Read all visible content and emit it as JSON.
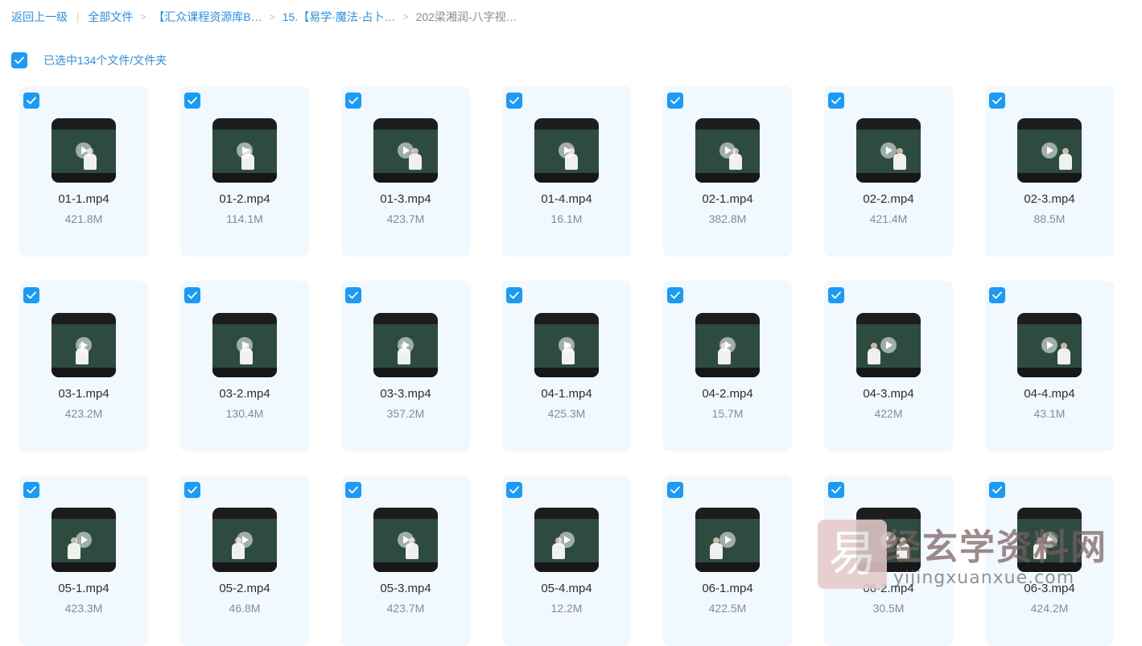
{
  "breadcrumb": {
    "back": "返回上一级",
    "separator": "|",
    "items": [
      "全部文件",
      "【汇众课程资源库B…",
      "15.【易学·魔法·占卜…"
    ],
    "current": "202梁湘润-八字视…"
  },
  "selection": {
    "text": "已选中134个文件/文件夹"
  },
  "colors": {
    "accent": "#1b9af7",
    "link": "#2d8ee8",
    "card_bg": "#f1f8fe",
    "size_text": "#858b94"
  },
  "files": [
    {
      "name": "01-1.mp4",
      "size": "421.8M"
    },
    {
      "name": "01-2.mp4",
      "size": "114.1M"
    },
    {
      "name": "01-3.mp4",
      "size": "423.7M"
    },
    {
      "name": "01-4.mp4",
      "size": "16.1M"
    },
    {
      "name": "02-1.mp4",
      "size": "382.8M"
    },
    {
      "name": "02-2.mp4",
      "size": "421.4M"
    },
    {
      "name": "02-3.mp4",
      "size": "88.5M"
    },
    {
      "name": "03-1.mp4",
      "size": "423.2M"
    },
    {
      "name": "03-2.mp4",
      "size": "130.4M"
    },
    {
      "name": "03-3.mp4",
      "size": "357.2M"
    },
    {
      "name": "04-1.mp4",
      "size": "425.3M"
    },
    {
      "name": "04-2.mp4",
      "size": "15.7M"
    },
    {
      "name": "04-3.mp4",
      "size": "422M"
    },
    {
      "name": "04-4.mp4",
      "size": "43.1M"
    },
    {
      "name": "05-1.mp4",
      "size": "423.3M"
    },
    {
      "name": "05-2.mp4",
      "size": "46.8M"
    },
    {
      "name": "05-3.mp4",
      "size": "423.7M"
    },
    {
      "name": "05-4.mp4",
      "size": "12.2M"
    },
    {
      "name": "06-1.mp4",
      "size": "422.5M"
    },
    {
      "name": "06-2.mp4",
      "size": "30.5M"
    },
    {
      "name": "06-3.mp4",
      "size": "424.2M"
    }
  ],
  "watermark": {
    "glyph": "易",
    "cn": "经玄学资料网",
    "url": "yijingxuanxue.com"
  },
  "icons": {
    "checkbox": "check-icon",
    "play": "play-icon"
  }
}
